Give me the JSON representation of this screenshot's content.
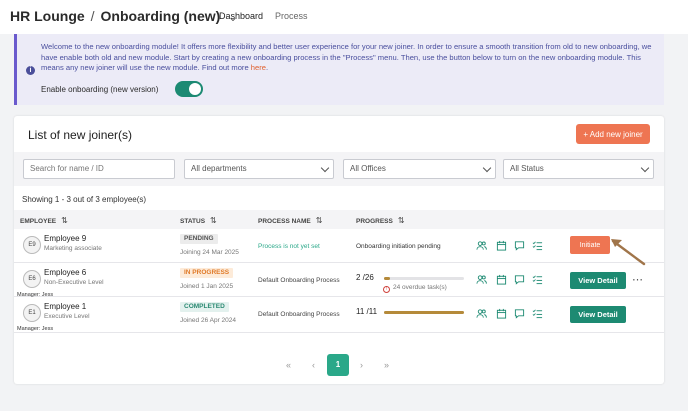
{
  "header": {
    "breadcrumb_root": "HR Lounge",
    "breadcrumb_separator": "/",
    "breadcrumb_current": "Onboarding (new)",
    "tabs": [
      {
        "label": "Dashboard",
        "active": true
      },
      {
        "label": "Process",
        "active": false
      }
    ]
  },
  "banner": {
    "message": "Welcome to the new onboarding module! It offers more flexibility and better user experience for your new joiner. In order to ensure a smooth transition from old to new onboarding, we have enable both old and new module. Start by creating a new onboarding process in the \"Process\" menu. Then, use the button below to turn on the new onboarding module. This means any new joiner will use the new module. Find out more",
    "link_text": "here",
    "link_suffix": ".",
    "toggle_label": "Enable onboarding (new version)",
    "toggle_on": true
  },
  "list": {
    "title": "List of new joiner(s)",
    "add_button": "+ Add new joiner",
    "filters": {
      "search_placeholder": "Search for name / ID",
      "department": "All departments",
      "office": "All Offices",
      "status": "All Status"
    },
    "showing": "Showing 1 - 3 out of 3 employee(s)",
    "columns": {
      "employee": "EMPLOYEE",
      "status": "STATUS",
      "process": "PROCESS NAME",
      "progress": "PROGRESS"
    },
    "rows": [
      {
        "initials": "E9",
        "name": "Employee 9",
        "role": "Marketing associate",
        "manager": "",
        "status": "PENDING",
        "joined": "Joining 24 Mar 2025",
        "process": "Process is not yet set",
        "progress_text": "Onboarding initiation pending",
        "action": "Initiate"
      },
      {
        "initials": "E6",
        "name": "Employee 6",
        "role": "Non-Executive Level",
        "manager": "Manager: Jess",
        "status": "IN PROGRESS",
        "joined": "Joined 1 Jan 2025",
        "process": "Default Onboarding Process",
        "progress_count": "2 /26",
        "progress_fraction": 0.077,
        "overdue": "24 overdue task(s)",
        "action": "View Detail",
        "more": "⋯"
      },
      {
        "initials": "E1",
        "name": "Employee 1",
        "role": "Executive Level",
        "manager": "Manager: Jess",
        "status": "COMPLETED",
        "joined": "Joined 26 Apr 2024",
        "process": "Default Onboarding Process",
        "progress_count": "11 /11",
        "progress_fraction": 1.0,
        "action": "View Detail"
      }
    ],
    "pagination": {
      "first": "«",
      "prev": "‹",
      "current": "1",
      "next": "›",
      "last": "»"
    }
  },
  "colors": {
    "accent_orange": "#ee7552",
    "accent_teal": "#1d8a72",
    "banner_bg": "#ecebf7",
    "banner_text": "#4a4f9e",
    "progress_fill": "#b58a3a"
  },
  "icons": [
    "people-icon",
    "calendar-icon",
    "chat-icon",
    "checklist-icon"
  ]
}
